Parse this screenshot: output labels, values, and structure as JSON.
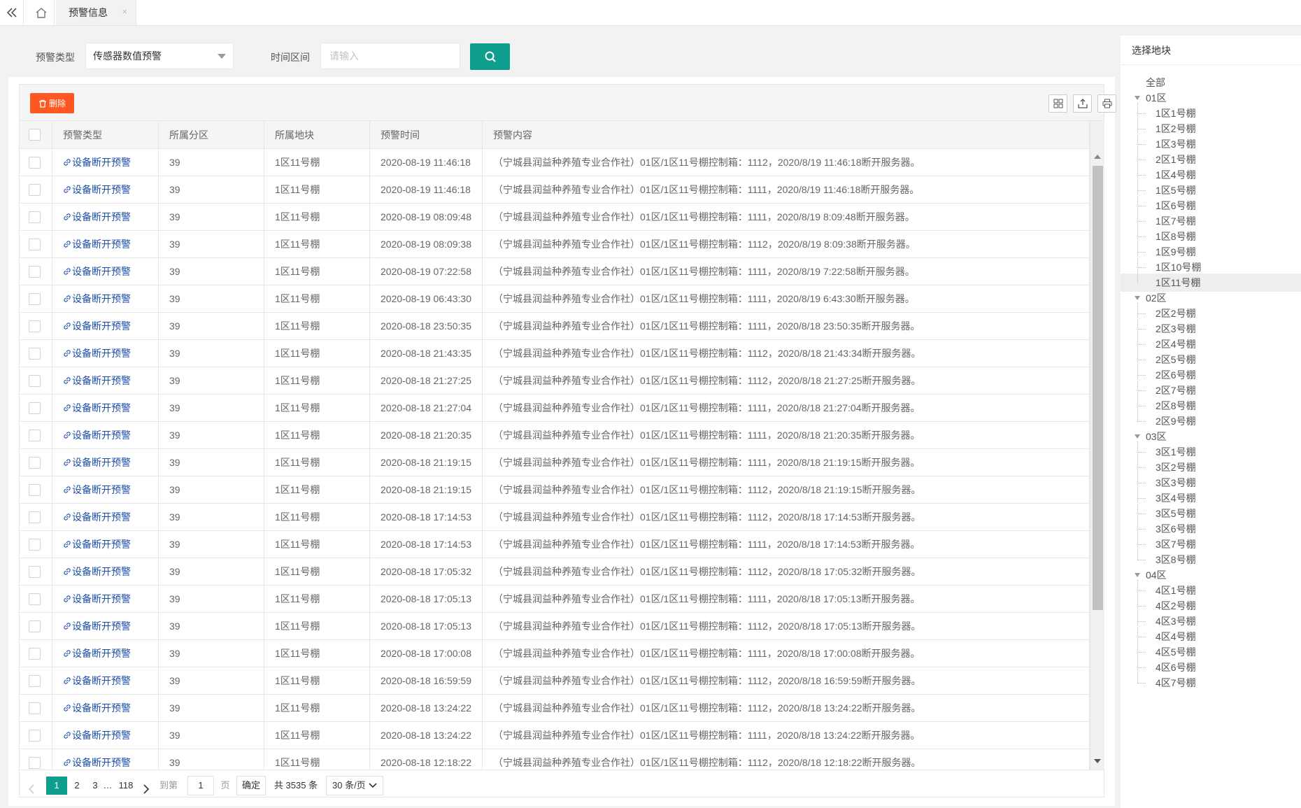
{
  "tabs": {
    "active_label": "预警信息",
    "close_glyph": "×"
  },
  "search": {
    "type_label": "预警类型",
    "type_value": "传感器数值预警",
    "time_label": "时间区间",
    "time_placeholder": "请输入"
  },
  "toolbar": {
    "delete_label": "删除"
  },
  "table": {
    "columns": [
      "预警类型",
      "所属分区",
      "所属地块",
      "预警时间",
      "预警内容"
    ],
    "rows": [
      [
        "设备断开预警",
        "39",
        "1区11号棚",
        "2020-08-19 11:46:18",
        "（宁城县润益种养殖专业合作社）01区/1区11号棚控制箱：1112，2020/8/19 11:46:18断开服务器。"
      ],
      [
        "设备断开预警",
        "39",
        "1区11号棚",
        "2020-08-19 11:46:18",
        "（宁城县润益种养殖专业合作社）01区/1区11号棚控制箱：1111，2020/8/19 11:46:18断开服务器。"
      ],
      [
        "设备断开预警",
        "39",
        "1区11号棚",
        "2020-08-19 08:09:48",
        "（宁城县润益种养殖专业合作社）01区/1区11号棚控制箱：1111，2020/8/19 8:09:48断开服务器。"
      ],
      [
        "设备断开预警",
        "39",
        "1区11号棚",
        "2020-08-19 08:09:38",
        "（宁城县润益种养殖专业合作社）01区/1区11号棚控制箱：1112，2020/8/19 8:09:38断开服务器。"
      ],
      [
        "设备断开预警",
        "39",
        "1区11号棚",
        "2020-08-19 07:22:58",
        "（宁城县润益种养殖专业合作社）01区/1区11号棚控制箱：1111，2020/8/19 7:22:58断开服务器。"
      ],
      [
        "设备断开预警",
        "39",
        "1区11号棚",
        "2020-08-19 06:43:30",
        "（宁城县润益种养殖专业合作社）01区/1区11号棚控制箱：1111，2020/8/19 6:43:30断开服务器。"
      ],
      [
        "设备断开预警",
        "39",
        "1区11号棚",
        "2020-08-18 23:50:35",
        "（宁城县润益种养殖专业合作社）01区/1区11号棚控制箱：1111，2020/8/18 23:50:35断开服务器。"
      ],
      [
        "设备断开预警",
        "39",
        "1区11号棚",
        "2020-08-18 21:43:35",
        "（宁城县润益种养殖专业合作社）01区/1区11号棚控制箱：1112，2020/8/18 21:43:34断开服务器。"
      ],
      [
        "设备断开预警",
        "39",
        "1区11号棚",
        "2020-08-18 21:27:25",
        "（宁城县润益种养殖专业合作社）01区/1区11号棚控制箱：1112，2020/8/18 21:27:25断开服务器。"
      ],
      [
        "设备断开预警",
        "39",
        "1区11号棚",
        "2020-08-18 21:27:04",
        "（宁城县润益种养殖专业合作社）01区/1区11号棚控制箱：1111，2020/8/18 21:27:04断开服务器。"
      ],
      [
        "设备断开预警",
        "39",
        "1区11号棚",
        "2020-08-18 21:20:35",
        "（宁城县润益种养殖专业合作社）01区/1区11号棚控制箱：1111，2020/8/18 21:20:35断开服务器。"
      ],
      [
        "设备断开预警",
        "39",
        "1区11号棚",
        "2020-08-18 21:19:15",
        "（宁城县润益种养殖专业合作社）01区/1区11号棚控制箱：1111，2020/8/18 21:19:15断开服务器。"
      ],
      [
        "设备断开预警",
        "39",
        "1区11号棚",
        "2020-08-18 21:19:15",
        "（宁城县润益种养殖专业合作社）01区/1区11号棚控制箱：1112，2020/8/18 21:19:15断开服务器。"
      ],
      [
        "设备断开预警",
        "39",
        "1区11号棚",
        "2020-08-18 17:14:53",
        "（宁城县润益种养殖专业合作社）01区/1区11号棚控制箱：1112，2020/8/18 17:14:53断开服务器。"
      ],
      [
        "设备断开预警",
        "39",
        "1区11号棚",
        "2020-08-18 17:14:53",
        "（宁城县润益种养殖专业合作社）01区/1区11号棚控制箱：1111，2020/8/18 17:14:53断开服务器。"
      ],
      [
        "设备断开预警",
        "39",
        "1区11号棚",
        "2020-08-18 17:05:32",
        "（宁城县润益种养殖专业合作社）01区/1区11号棚控制箱：1112，2020/8/18 17:05:32断开服务器。"
      ],
      [
        "设备断开预警",
        "39",
        "1区11号棚",
        "2020-08-18 17:05:13",
        "（宁城县润益种养殖专业合作社）01区/1区11号棚控制箱：1111，2020/8/18 17:05:13断开服务器。"
      ],
      [
        "设备断开预警",
        "39",
        "1区11号棚",
        "2020-08-18 17:05:13",
        "（宁城县润益种养殖专业合作社）01区/1区11号棚控制箱：1112，2020/8/18 17:05:13断开服务器。"
      ],
      [
        "设备断开预警",
        "39",
        "1区11号棚",
        "2020-08-18 17:00:08",
        "（宁城县润益种养殖专业合作社）01区/1区11号棚控制箱：1111，2020/8/18 17:00:08断开服务器。"
      ],
      [
        "设备断开预警",
        "39",
        "1区11号棚",
        "2020-08-18 16:59:59",
        "（宁城县润益种养殖专业合作社）01区/1区11号棚控制箱：1112，2020/8/18 16:59:59断开服务器。"
      ],
      [
        "设备断开预警",
        "39",
        "1区11号棚",
        "2020-08-18 13:24:22",
        "（宁城县润益种养殖专业合作社）01区/1区11号棚控制箱：1112，2020/8/18 13:24:22断开服务器。"
      ],
      [
        "设备断开预警",
        "39",
        "1区11号棚",
        "2020-08-18 13:24:22",
        "（宁城县润益种养殖专业合作社）01区/1区11号棚控制箱：1111，2020/8/18 13:24:22断开服务器。"
      ],
      [
        "设备断开预警",
        "39",
        "1区11号棚",
        "2020-08-18 12:18:22",
        "（宁城县润益种养殖专业合作社）01区/1区11号棚控制箱：1112，2020/8/18 12:18:22断开服务器。"
      ]
    ]
  },
  "pagination": {
    "pages": [
      "1",
      "2",
      "3",
      "…",
      "118"
    ],
    "goto_label": "到第",
    "goto_value": "1",
    "page_unit": "页",
    "confirm_label": "确定",
    "total_label": "共 3535 条",
    "page_size_label": "30 条/页"
  },
  "sidebar": {
    "title": "选择地块",
    "all_label": "全部",
    "groups": [
      {
        "label": "01区",
        "items": [
          "1区1号棚",
          "1区2号棚",
          "1区3号棚",
          "2区1号棚",
          "1区4号棚",
          "1区5号棚",
          "1区6号棚",
          "1区7号棚",
          "1区8号棚",
          "1区9号棚",
          "1区10号棚",
          "1区11号棚"
        ]
      },
      {
        "label": "02区",
        "items": [
          "2区2号棚",
          "2区3号棚",
          "2区4号棚",
          "2区5号棚",
          "2区6号棚",
          "2区7号棚",
          "2区8号棚",
          "2区9号棚"
        ]
      },
      {
        "label": "03区",
        "items": [
          "3区1号棚",
          "3区2号棚",
          "3区3号棚",
          "3区4号棚",
          "3区5号棚",
          "3区6号棚",
          "3区7号棚",
          "3区8号棚"
        ]
      },
      {
        "label": "04区",
        "items": [
          "4区1号棚",
          "4区2号棚",
          "4区3号棚",
          "4区4号棚",
          "4区5号棚",
          "4区6号棚",
          "4区7号棚"
        ]
      }
    ],
    "selected_item": "1区11号棚"
  },
  "colors": {
    "accent": "#0f9d8d",
    "danger": "#ff5722",
    "link": "#1e4fa8"
  },
  "icons": [
    "double-chevron-left-icon",
    "home-icon",
    "search-icon",
    "trash-icon",
    "columns-icon",
    "export-icon",
    "print-icon",
    "link-icon",
    "chevron-left-icon",
    "chevron-right-icon",
    "chevron-down-icon",
    "triangle-down-icon"
  ]
}
